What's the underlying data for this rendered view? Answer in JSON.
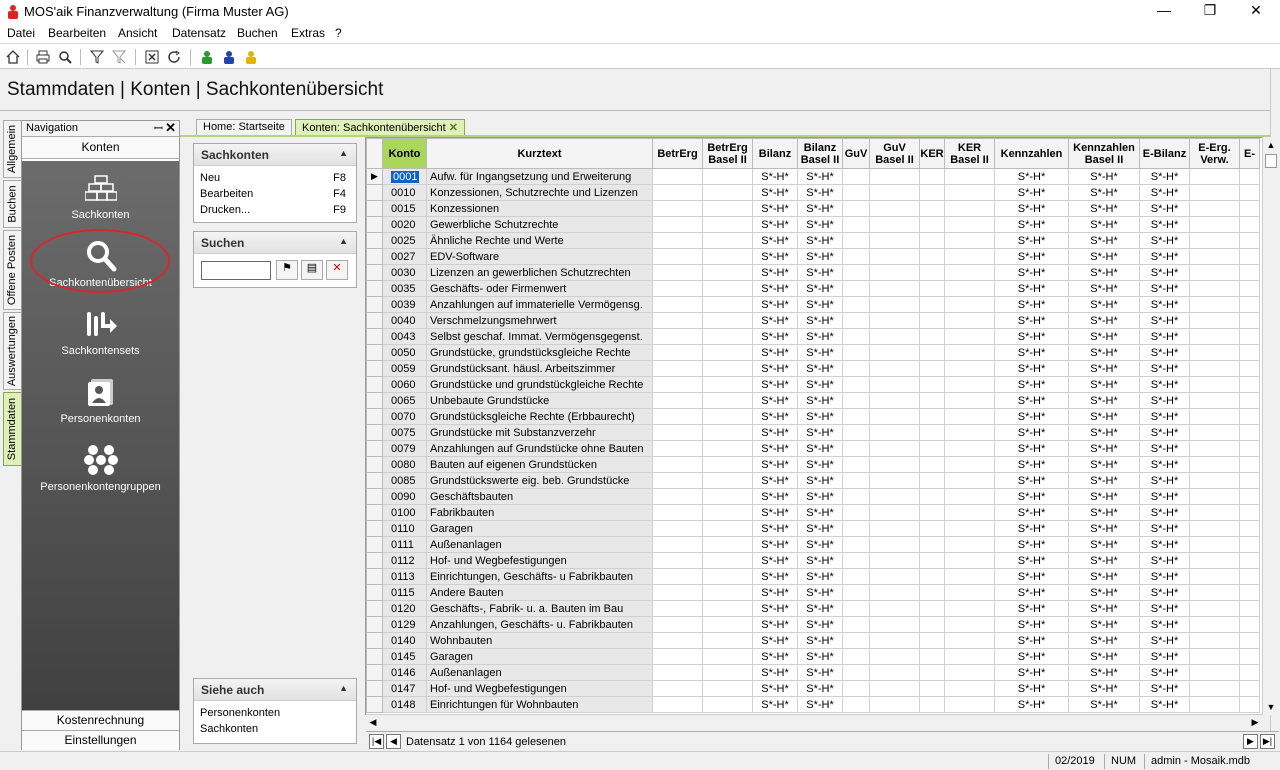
{
  "window": {
    "title": "MOS'aik Finanzverwaltung (Firma Muster AG)",
    "minimize": "—",
    "maximize": "❐",
    "close": "✕"
  },
  "menu": [
    "Datei",
    "Bearbeiten",
    "Ansicht",
    "Datensatz",
    "Buchen",
    "Extras",
    "?"
  ],
  "toolbar_icons": [
    "home-icon",
    "print-icon",
    "preview-icon",
    "filter-icon",
    "filter-clear-icon",
    "close-doc-icon",
    "refresh-icon",
    "user-green-icon",
    "user-blue-icon",
    "user-yellow-icon"
  ],
  "page_title": "Stammdaten | Konten | Sachkontenübersicht",
  "vtabs": [
    "Allgemein",
    "Buchen",
    "Offene Posten",
    "Auswertungen",
    "Stammdaten"
  ],
  "navigation": {
    "header": "Navigation",
    "group": "Konten",
    "items": [
      {
        "label": "Sachkonten",
        "icon": "bricks-icon"
      },
      {
        "label": "Sachkontenübersicht",
        "icon": "magnifier-icon"
      },
      {
        "label": "Sachkontensets",
        "icon": "sets-icon"
      },
      {
        "label": "Personenkonten",
        "icon": "person-card-icon"
      },
      {
        "label": "Personenkontengruppen",
        "icon": "group-icon"
      }
    ],
    "bottom": [
      "Kostenrechnung",
      "Einstellungen"
    ]
  },
  "doc_tabs": [
    {
      "label": "Home: Startseite",
      "active": false
    },
    {
      "label": "Konten: Sachkontenübersicht",
      "active": true
    }
  ],
  "sidebar": {
    "sachkonten": {
      "title": "Sachkonten",
      "items": [
        {
          "label": "Neu",
          "key": "F8"
        },
        {
          "label": "Bearbeiten",
          "key": "F4"
        },
        {
          "label": "Drucken...",
          "key": "F9"
        }
      ]
    },
    "suchen": {
      "title": "Suchen"
    },
    "siehe_auch": {
      "title": "Siehe auch",
      "items": [
        "Personenkonten",
        "Sachkonten"
      ]
    }
  },
  "grid": {
    "columns": [
      "Konto",
      "Kurztext",
      "BetrErg",
      "BetrErg Basel II",
      "Bilanz",
      "Bilanz Basel II",
      "GuV",
      "GuV Basel II",
      "KER",
      "KER Basel II",
      "Kennzahlen",
      "Kennzahlen Basel II",
      "E-Bilanz",
      "E-Erg. Verw.",
      "E-"
    ],
    "flag": "S*-H*",
    "rows": [
      [
        "0001",
        "Aufw. für Ingangsetzung und Erweiterung"
      ],
      [
        "0010",
        "Konzessionen, Schutzrechte und Lizenzen"
      ],
      [
        "0015",
        "Konzessionen"
      ],
      [
        "0020",
        "Gewerbliche Schutzrechte"
      ],
      [
        "0025",
        "Ähnliche Rechte und Werte"
      ],
      [
        "0027",
        "EDV-Software"
      ],
      [
        "0030",
        "Lizenzen an gewerblichen Schutzrechten"
      ],
      [
        "0035",
        "Geschäfts- oder Firmenwert"
      ],
      [
        "0039",
        "Anzahlungen auf immaterielle Vermögensg."
      ],
      [
        "0040",
        "Verschmelzungsmehrwert"
      ],
      [
        "0043",
        "Selbst geschaf. Immat. Vermögensgegenst."
      ],
      [
        "0050",
        "Grundstücke, grundstücksgleiche Rechte"
      ],
      [
        "0059",
        "Grundstücksant. häusl. Arbeitszimmer"
      ],
      [
        "0060",
        "Grundstücke und grundstückgleiche Rechte"
      ],
      [
        "0065",
        "Unbebaute Grundstücke"
      ],
      [
        "0070",
        "Grundstücksgleiche Rechte (Erbbaurecht)"
      ],
      [
        "0075",
        "Grundstücke mit Substanzverzehr"
      ],
      [
        "0079",
        "Anzahlungen auf Grundstücke ohne Bauten"
      ],
      [
        "0080",
        "Bauten auf eigenen Grundstücken"
      ],
      [
        "0085",
        "Grundstückswerte eig. beb. Grundstücke"
      ],
      [
        "0090",
        "Geschäftsbauten"
      ],
      [
        "0100",
        "Fabrikbauten"
      ],
      [
        "0110",
        "Garagen"
      ],
      [
        "0111",
        "Außenanlagen"
      ],
      [
        "0112",
        "Hof- und Wegbefestigungen"
      ],
      [
        "0113",
        "Einrichtungen, Geschäfts- u Fabrikbauten"
      ],
      [
        "0115",
        "Andere Bauten"
      ],
      [
        "0120",
        "Geschäfts-, Fabrik- u. a. Bauten im Bau"
      ],
      [
        "0129",
        "Anzahlungen, Geschäfts- u. Fabrikbauten"
      ],
      [
        "0140",
        "Wohnbauten"
      ],
      [
        "0145",
        "Garagen"
      ],
      [
        "0146",
        "Außenanlagen"
      ],
      [
        "0147",
        "Hof- und Wegbefestigungen"
      ],
      [
        "0148",
        "Einrichtungen für Wohnbauten"
      ]
    ]
  },
  "record_nav": {
    "text": "Datensatz 1 von 1164 gelesenen"
  },
  "status": {
    "period": "02/2019",
    "num": "NUM",
    "user": "admin - Mosaik.mdb"
  }
}
